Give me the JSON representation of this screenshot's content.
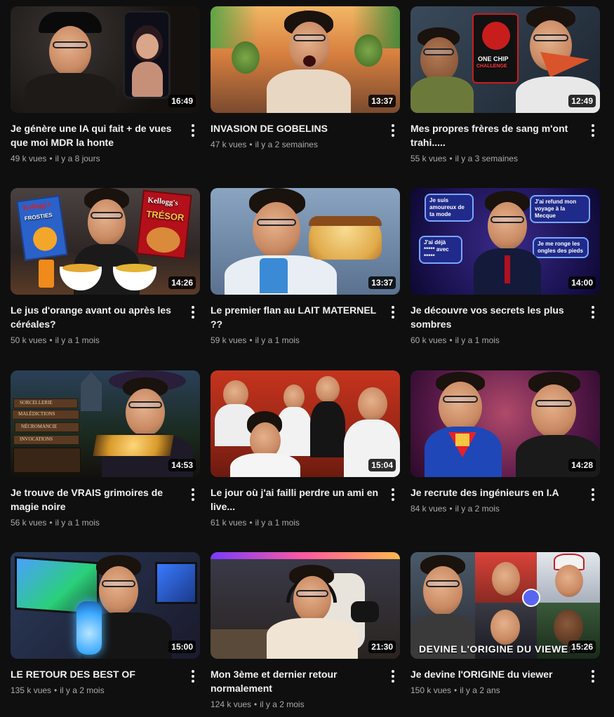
{
  "videos": [
    {
      "title": "Je génère une IA qui fait + de vues que moi MDR la honte",
      "views": "49 k vues",
      "age": "il y a 8 jours",
      "duration": "16:49"
    },
    {
      "title": "INVASION DE GOBELINS",
      "views": "47 k vues",
      "age": "il y a 2 semaines",
      "duration": "13:37"
    },
    {
      "title": "Mes propres frères de sang m'ont trahi.....",
      "views": "55 k vues",
      "age": "il y a 3 semaines",
      "duration": "12:49"
    },
    {
      "title": "Le jus d'orange avant ou après les céréales?",
      "views": "50 k vues",
      "age": "il y a 1 mois",
      "duration": "14:26"
    },
    {
      "title": "Le premier flan au LAIT MATERNEL ??",
      "views": "59 k vues",
      "age": "il y a 1 mois",
      "duration": "13:37"
    },
    {
      "title": "Je découvre vos secrets les plus sombres",
      "views": "60 k vues",
      "age": "il y a 1 mois",
      "duration": "14:00"
    },
    {
      "title": "Je trouve de VRAIS grimoires de magie noire",
      "views": "56 k vues",
      "age": "il y a 1 mois",
      "duration": "14:53"
    },
    {
      "title": "Le jour où j'ai failli perdre un ami en live...",
      "views": "61 k vues",
      "age": "il y a 1 mois",
      "duration": "15:04"
    },
    {
      "title": "Je recrute des ingénieurs en I.A",
      "views": "84 k vues",
      "age": "il y a 2 mois",
      "duration": "14:28"
    },
    {
      "title": "LE RETOUR DES BEST OF",
      "views": "135 k vues",
      "age": "il y a 2 mois",
      "duration": "15:00"
    },
    {
      "title": "Mon 3ème et dernier retour normalement",
      "views": "124 k vues",
      "age": "il y a 2 mois",
      "duration": "21:30"
    },
    {
      "title": "Je devine l'ORIGINE du viewer",
      "views": "150 k vues",
      "age": "il y a 2 ans",
      "duration": "15:26"
    }
  ],
  "thumb_text": {
    "chip_line1": "ONE CHIP",
    "chip_line2": "CHALLENGE",
    "frosties_brand": "Kellogg's",
    "frosties_name": "FROSTIES",
    "tresor_brand": "Kellogg's",
    "tresor_name": "TRÉSOR",
    "bubble1": "Je suis amoureux de ta mode",
    "bubble2": "J'ai refund mon voyage à la Mecque",
    "bubble3": "J'ai déjà ***** avec *****",
    "bubble4": "Je me ronge les ongles des pieds",
    "book1": "SORCELLERIE",
    "book2": "MALÉDICTIONS",
    "book3": "NÉCROMANCIE",
    "book4": "INVOCATIONS",
    "viewer_banner": "DEVINE L'ORIGINE DU VIEWER"
  },
  "separator": "•",
  "colors": {
    "background": "#0f0f0f",
    "title": "#f1f1f1",
    "meta": "#aaaaaa",
    "duration_bg": "#000000"
  }
}
